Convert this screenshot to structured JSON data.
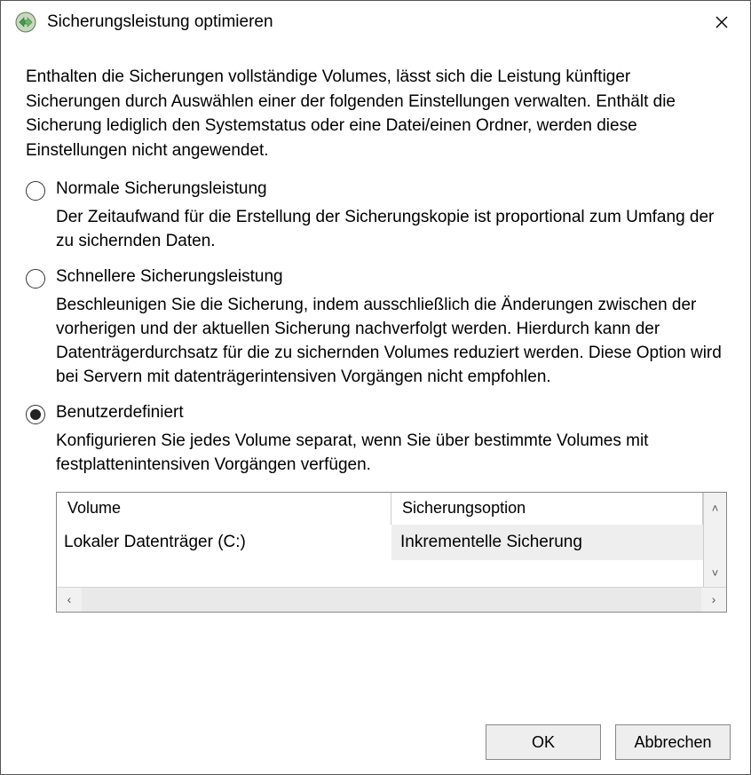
{
  "window": {
    "title": "Sicherungsleistung optimieren"
  },
  "intro": "Enthalten die Sicherungen vollständige Volumes, lässt sich die Leistung künftiger Sicherungen durch Auswählen einer der folgenden Einstellungen verwalten. Enthält die Sicherung lediglich den Systemstatus oder eine Datei/einen Ordner, werden diese Einstellungen nicht angewendet.",
  "options": {
    "normal": {
      "label": "Normale Sicherungsleistung",
      "desc": "Der Zeitaufwand für die Erstellung der Sicherungskopie ist proportional zum Umfang der zu sichernden Daten.",
      "selected": false
    },
    "faster": {
      "label": "Schnellere Sicherungsleistung",
      "desc": "Beschleunigen Sie die Sicherung, indem ausschließlich die Änderungen zwischen der vorherigen und der aktuellen Sicherung nachverfolgt werden. Hierdurch kann der Datenträgerdurchsatz für die zu sichernden Volumes reduziert werden. Diese Option wird bei Servern mit datenträgerintensiven Vorgängen nicht empfohlen.",
      "selected": false
    },
    "custom": {
      "label": "Benutzerdefiniert",
      "desc": "Konfigurieren Sie jedes Volume separat, wenn Sie über bestimmte Volumes mit festplattenintensiven Vorgängen verfügen.",
      "selected": true
    }
  },
  "table": {
    "headers": {
      "volume": "Volume",
      "option": "Sicherungsoption"
    },
    "rows": [
      {
        "volume": "Lokaler Datenträger (C:)",
        "option": "Inkrementelle Sicherung"
      }
    ]
  },
  "buttons": {
    "ok": "OK",
    "cancel": "Abbrechen"
  }
}
